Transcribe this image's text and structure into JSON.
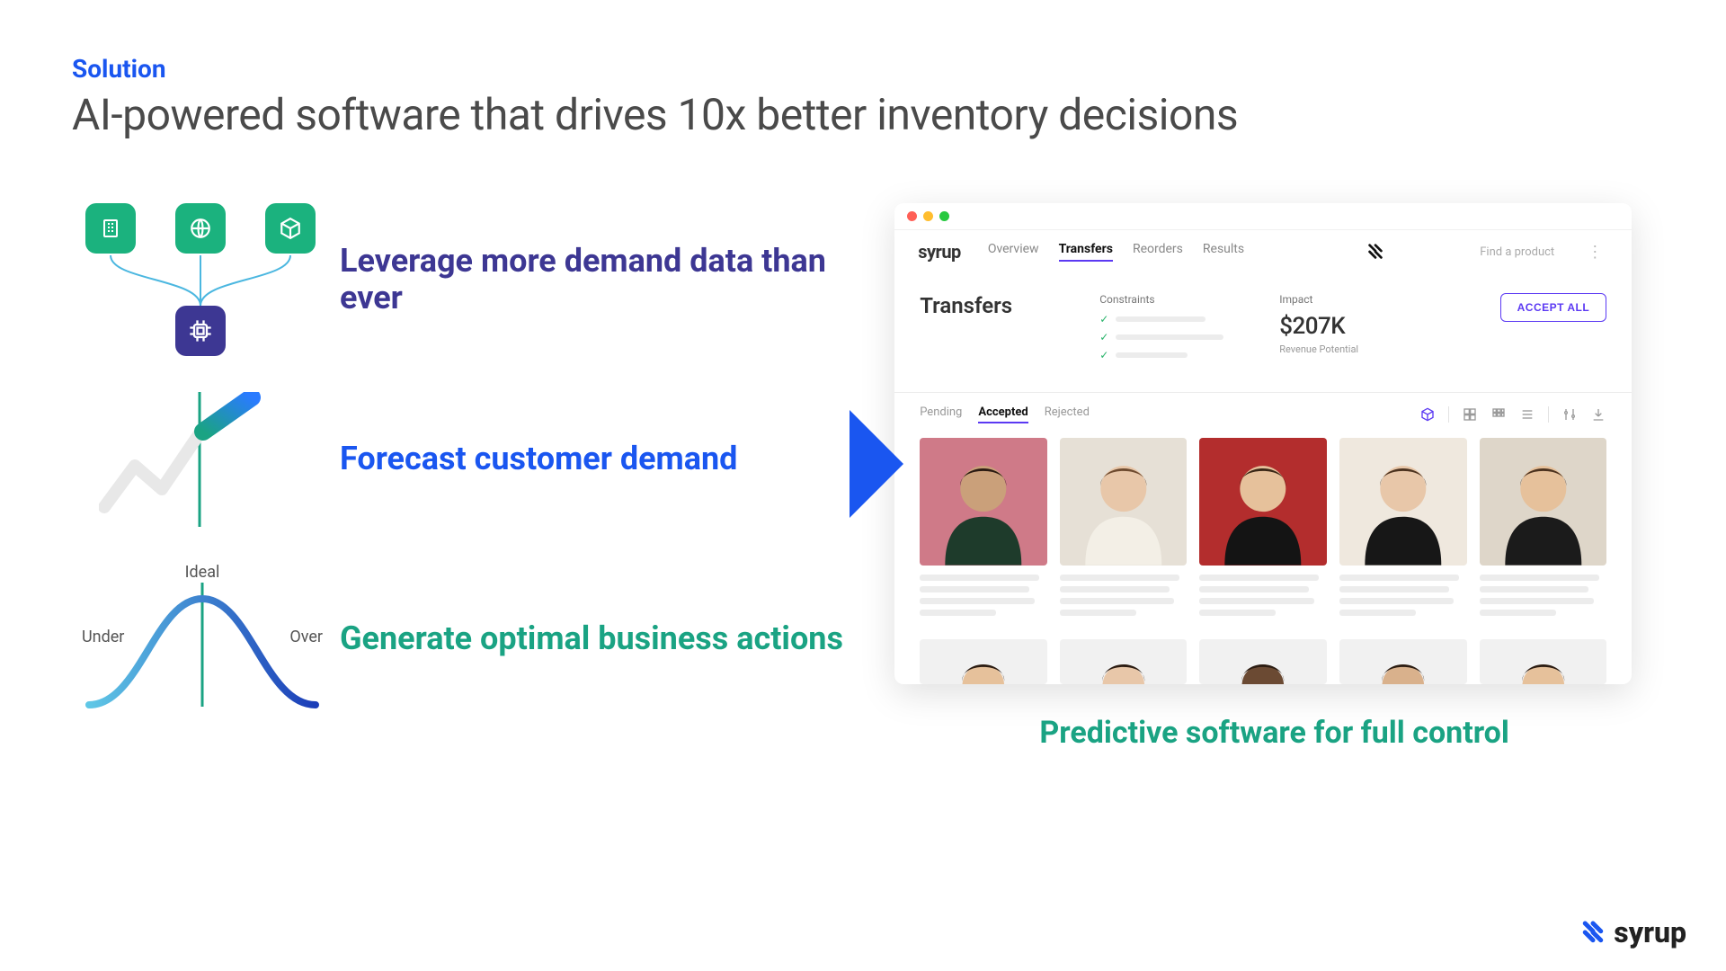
{
  "header": {
    "eyebrow": "Solution",
    "headline": "AI-powered software that drives 10x better inventory decisions"
  },
  "features": {
    "f1_text": "Leverage more demand data than ever",
    "f2_text": "Forecast customer demand",
    "f3_text": "Generate optimal business actions",
    "bell": {
      "ideal": "Ideal",
      "under": "Under",
      "over": "Over"
    }
  },
  "app": {
    "logo": "syrup",
    "nav": [
      "Overview",
      "Transfers",
      "Reorders",
      "Results"
    ],
    "nav_active_index": 1,
    "search_placeholder": "Find a product",
    "page_title": "Transfers",
    "constraints_label": "Constraints",
    "impact_label": "Impact",
    "impact_value": "$207K",
    "impact_subtitle": "Revenue Potential",
    "accept_button": "ACCEPT ALL",
    "tabs": [
      "Pending",
      "Accepted",
      "Rejected"
    ],
    "tabs_active_index": 1,
    "product_colors": [
      "#cf7a88",
      "#e6e0d6",
      "#b32d2d",
      "#efe8de",
      "#ded6c9"
    ]
  },
  "tagline": "Predictive software for full control",
  "brand": {
    "name": "syrup"
  }
}
